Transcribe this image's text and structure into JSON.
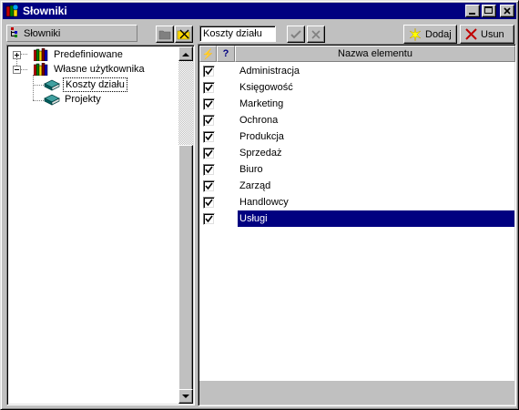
{
  "window": {
    "title": "Słowniki",
    "title_icon": "dictionary-app-icon"
  },
  "left_panel": {
    "header_label": "Słowniki",
    "tree": [
      {
        "label": "Predefiniowane",
        "icon": "books-icon",
        "expander": "+"
      },
      {
        "label": "Własne użytkownika",
        "icon": "books-icon",
        "expander": "-"
      },
      {
        "label": "Koszty działu",
        "icon": "book-icon",
        "selected": true
      },
      {
        "label": "Projekty",
        "icon": "book-icon"
      }
    ]
  },
  "toolbar": {
    "name_value": "Koszty działu",
    "add_label": "Dodaj",
    "remove_label": "Usun"
  },
  "grid": {
    "col_active_symbol": "⚡",
    "col_help_symbol": "?",
    "col_name_header": "Nazwa elementu",
    "rows": [
      {
        "checked": true,
        "name": "Administracja"
      },
      {
        "checked": true,
        "name": "Księgowość"
      },
      {
        "checked": true,
        "name": "Marketing"
      },
      {
        "checked": true,
        "name": "Ochrona"
      },
      {
        "checked": true,
        "name": "Produkcja"
      },
      {
        "checked": true,
        "name": "Sprzedaż"
      },
      {
        "checked": true,
        "name": "Biuro"
      },
      {
        "checked": true,
        "name": "Zarząd"
      },
      {
        "checked": true,
        "name": "Handlowcy"
      },
      {
        "checked": true,
        "name": "Usługi",
        "selected": true
      }
    ]
  },
  "colors": {
    "title_bar": "#000080",
    "selection": "#000080",
    "face": "#c0c0c0"
  }
}
